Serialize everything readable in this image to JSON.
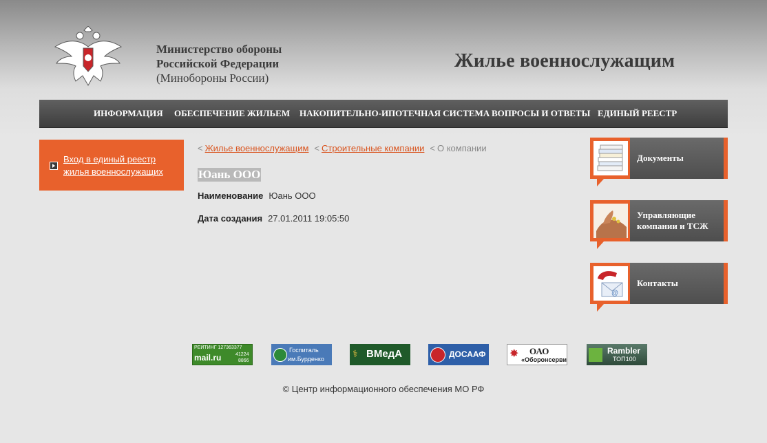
{
  "header": {
    "ministry_line1": "Министерство обороны",
    "ministry_line2": "Российской Федерации",
    "ministry_line3": "(Минобороны России)",
    "site_title": "Жилье военнослужащим",
    "emblem": "double-headed-eagle-emblem"
  },
  "nav": {
    "items": [
      {
        "label": "ИНФОРМАЦИЯ"
      },
      {
        "label": "ОБЕСПЕЧЕНИЕ ЖИЛЬЕМ"
      },
      {
        "label": "НАКОПИТЕЛЬНО-ИПОТЕЧНАЯ СИСТЕМА"
      },
      {
        "label": "ВОПРОСЫ И ОТВЕТЫ"
      },
      {
        "label": "ЕДИНЫЙ РЕЕСТР"
      }
    ]
  },
  "sidebar_left": {
    "login_link": "Вход в единый реестр жилья военнослужащих"
  },
  "breadcrumb": {
    "sep": "<",
    "items": [
      {
        "label": "Жилье военнослужащим"
      },
      {
        "label": "Строительные компании"
      },
      {
        "label": "О компании"
      }
    ]
  },
  "company": {
    "title": "Юань ООО",
    "fields": [
      {
        "label": "Наименование",
        "value": "Юань ООО"
      },
      {
        "label": "Дата создания",
        "value": "27.01.2011 19:05:50"
      }
    ]
  },
  "sidebar_right": {
    "cards": [
      {
        "label": "Документы",
        "icon": "documents-icon"
      },
      {
        "label": "Управляющие компании и ТСЖ",
        "icon": "hand-coins-icon"
      },
      {
        "label": "Контакты",
        "icon": "phone-email-icon"
      }
    ]
  },
  "banners": [
    {
      "line1": "РЕЙТИНГ 127363377",
      "line2": "mail.ru",
      "line3": "41224",
      "line4": "8866"
    },
    {
      "line1": "Госпиталь",
      "line2": "им.Бурденко"
    },
    {
      "line1": "ВМедА"
    },
    {
      "line1": "ДОСААФ"
    },
    {
      "line1": "ОАО",
      "line2": "«Оборонсервис»"
    },
    {
      "line1": "Rambler",
      "line2": "ТОП100"
    }
  ],
  "footer": {
    "copyright": "© Центр информационного обеспечения МО РФ"
  },
  "colors": {
    "accent": "#e8612c",
    "nav_bg": "#4a4a4a",
    "card_bg": "#5a5a5a",
    "link": "#d9531d"
  }
}
